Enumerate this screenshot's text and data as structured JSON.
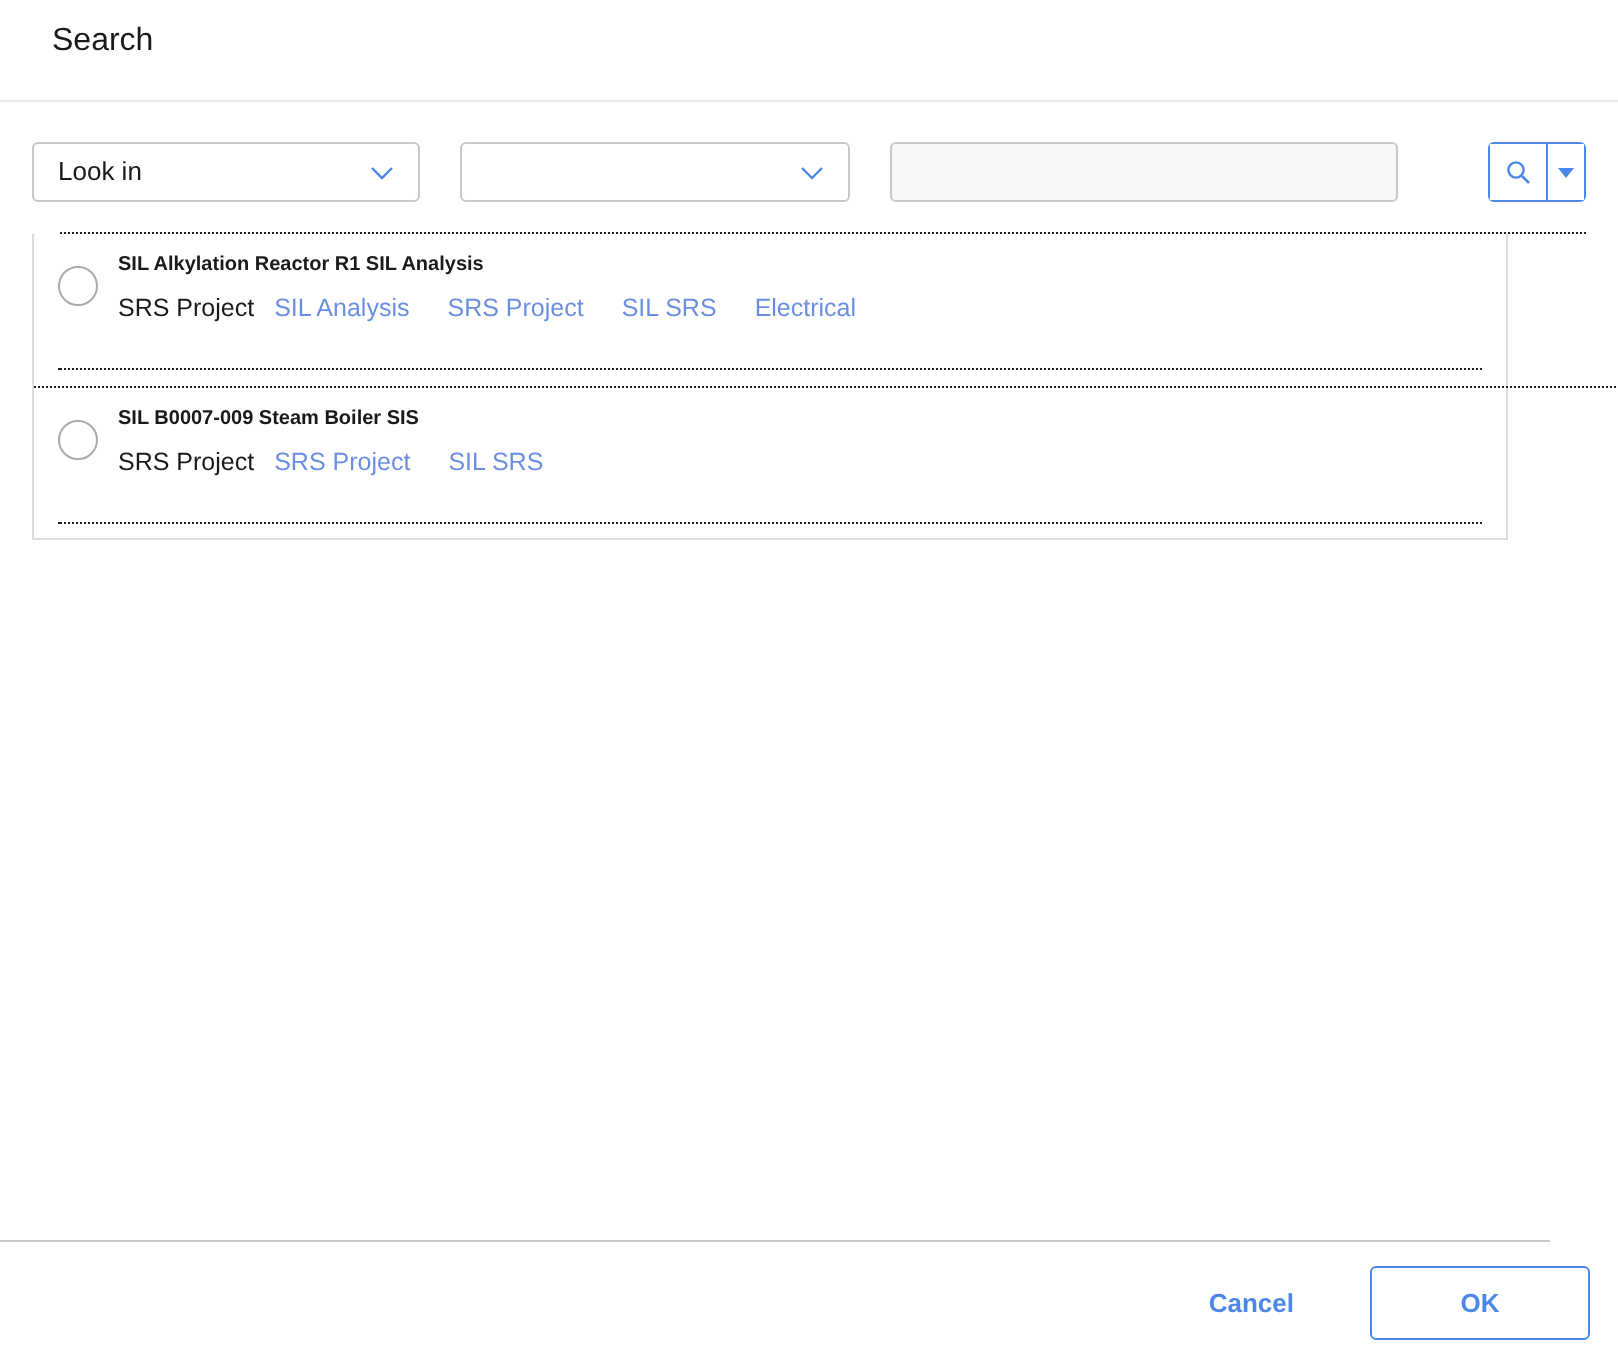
{
  "window": {
    "title": "Search"
  },
  "filters": {
    "look_in": {
      "value": "Look in"
    }
  },
  "results": [
    {
      "title": "SIL Alkylation Reactor R1 SIL Analysis",
      "selected": false,
      "family": "SRS Project",
      "tags": [
        "SIL Analysis",
        "SRS Project",
        "SIL SRS",
        "Electrical"
      ]
    },
    {
      "title": "SIL B0007-009 Steam Boiler SIS",
      "selected": false,
      "family": "SRS Project",
      "tags": [
        "SRS Project",
        "SIL SRS"
      ]
    }
  ],
  "buttons": {
    "cancel": "Cancel",
    "ok": "OK"
  }
}
